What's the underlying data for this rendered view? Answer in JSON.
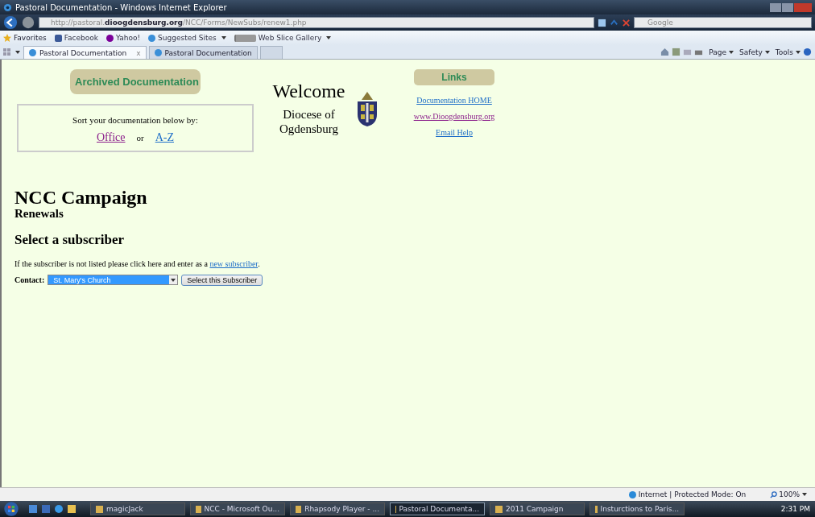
{
  "window": {
    "title": "Pastoral Documentation - Windows Internet Explorer"
  },
  "address_bar": {
    "url_prefix": "http://pastoral.",
    "url_domain": "dioogdensburg.org",
    "url_path": "/NCC/Forms/NewSubs/renew1.php",
    "search_placeholder": "Google"
  },
  "favorites_bar": {
    "label": "Favorites",
    "links": [
      {
        "label": "Facebook",
        "kind": "facebook",
        "dropdown": false
      },
      {
        "label": "Yahoo!",
        "kind": "yahoo",
        "dropdown": false
      },
      {
        "label": "Suggested Sites",
        "kind": "ie",
        "dropdown": true
      },
      {
        "label": "Web Slice Gallery",
        "kind": "page",
        "dropdown": true
      }
    ]
  },
  "tabs": [
    {
      "label": "Pastoral Documentation",
      "selected": true,
      "close": "x"
    },
    {
      "label": "Pastoral Documentation",
      "selected": false
    }
  ],
  "command_bar": [
    "Page",
    "Safety",
    "Tools"
  ],
  "page": {
    "archived_button": "Archived Documentation",
    "sort_box": {
      "text": "Sort your documentation below by:",
      "links": [
        {
          "label": "Office",
          "visited": true
        },
        {
          "label": "A-Z",
          "visited": false
        }
      ],
      "separator": "or"
    },
    "welcome": "Welcome",
    "diocese": "Diocese of Ogdensburg",
    "links_header": "Links",
    "links": [
      {
        "label": "Documentation HOME",
        "visited": false
      },
      {
        "label": "www.Dioogdensburg.org",
        "visited": true
      },
      {
        "label": "Email Help",
        "visited": false
      }
    ],
    "heading": "NCC Campaign",
    "subheading": "Renewals",
    "section": "Select a subscriber",
    "instruction": "If the subscriber is not listed please click here and enter as a",
    "instruction_link": "new subscriber",
    "instruction_end": ".",
    "contact_label": "Contact:",
    "contact_value": "St. Mary's Church",
    "submit": "Select this Subscriber"
  },
  "status_bar": {
    "zone": "Internet | Protected Mode: On",
    "zoom": "100%"
  },
  "taskbar": {
    "items": [
      {
        "label": "magicJack",
        "selected": false
      },
      {
        "label": "NCC - Microsoft Ou...",
        "selected": false
      },
      {
        "label": "Rhapsody Player - ...",
        "selected": false
      },
      {
        "label": "Pastoral Documenta...",
        "selected": true
      },
      {
        "label": "2011 Campaign",
        "selected": false
      },
      {
        "label": "Insturctions to Paris...",
        "selected": false
      }
    ],
    "clock": "2:31 PM"
  }
}
